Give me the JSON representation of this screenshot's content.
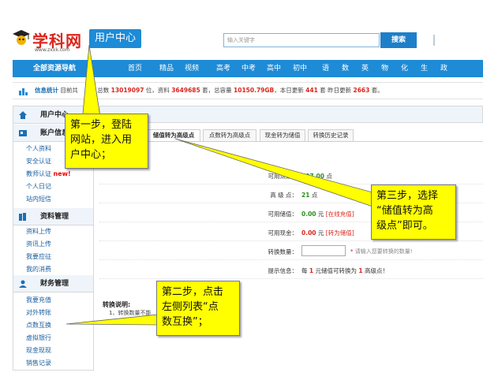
{
  "header": {
    "logo_text": "学科网",
    "logo_url": "www.zxxk.com",
    "user_center": "用户中心",
    "search_placeholder": "输入关键字",
    "search_button": "搜索"
  },
  "nav": {
    "all_resources": "全部资源导航",
    "items": [
      "首页",
      "精品",
      "视频",
      "高考",
      "中考",
      "高中",
      "初中",
      "语",
      "数",
      "英",
      "物",
      "化",
      "生",
      "政"
    ]
  },
  "stats": {
    "label": "信息统计",
    "prefix": "目前共",
    "fragment_1": "总数",
    "total": "13019097",
    "unit_pos": "位，资料",
    "docs": "3649685",
    "unit_docs": "套，总容量",
    "capacity": "10150.79GB",
    "today_label": "，本日更新",
    "today": "441",
    "unit_today": "套  昨日更新",
    "yesterday": "2663",
    "unit_yesterday": "套。"
  },
  "sidebar": {
    "head_1": "用户中心",
    "head_2": "账户信息",
    "group_2": [
      "个人资料",
      "安全认证",
      "教师认证",
      "个人日记",
      "站内短信"
    ],
    "new_badge": "new!",
    "head_3": "资料管理",
    "group_3": [
      "资料上传",
      "资讯上传",
      "我要应征",
      "我的消费"
    ],
    "head_4": "财务管理",
    "group_4": [
      "我要充值",
      "对外转账",
      "点数互换",
      "虚拟银行",
      "现金现现",
      "销售记录"
    ]
  },
  "tabs": [
    "储值转为高级点",
    "点数转为高级点",
    "现金转为储值",
    "转换历史记录"
  ],
  "form": {
    "usable_points_label": "可用点数：",
    "usable_points_value": "497.00",
    "usable_points_unit": "点",
    "advanced_label": "高 级 点：",
    "advanced_value": "21",
    "advanced_unit": "点",
    "stored_label": "可用储值：",
    "stored_value": "0.00",
    "stored_unit": "元",
    "stored_link": "[在线充值]",
    "cash_label": "可用现金：",
    "cash_value": "0.00",
    "cash_unit": "元",
    "cash_link": "[转为储值]",
    "amount_label": "转换数量：",
    "amount_star": "*",
    "amount_hint": "请输入您要转换的数量!",
    "tip_label": "提示信息：",
    "tip_pre": "每",
    "tip_n1": "1",
    "tip_mid": "元储值可转换为",
    "tip_n2": "1",
    "tip_post": "高级点！"
  },
  "notes": {
    "title": "转换说明:",
    "line_1": "1、转换数量不能"
  },
  "callouts": {
    "step1": "第一步，登陆\n网站，进入用\n户中心；",
    "step2": "第二步，点击\n左侧列表“点\n数互换”；",
    "step3": "第三步，选择\n“储值转为高\n级点”即可。"
  },
  "colors": {
    "brand_blue": "#1e8bd6",
    "logo_red": "#d9261c",
    "callout_yellow": "#ffff00",
    "value_green": "#2a8f1e"
  }
}
